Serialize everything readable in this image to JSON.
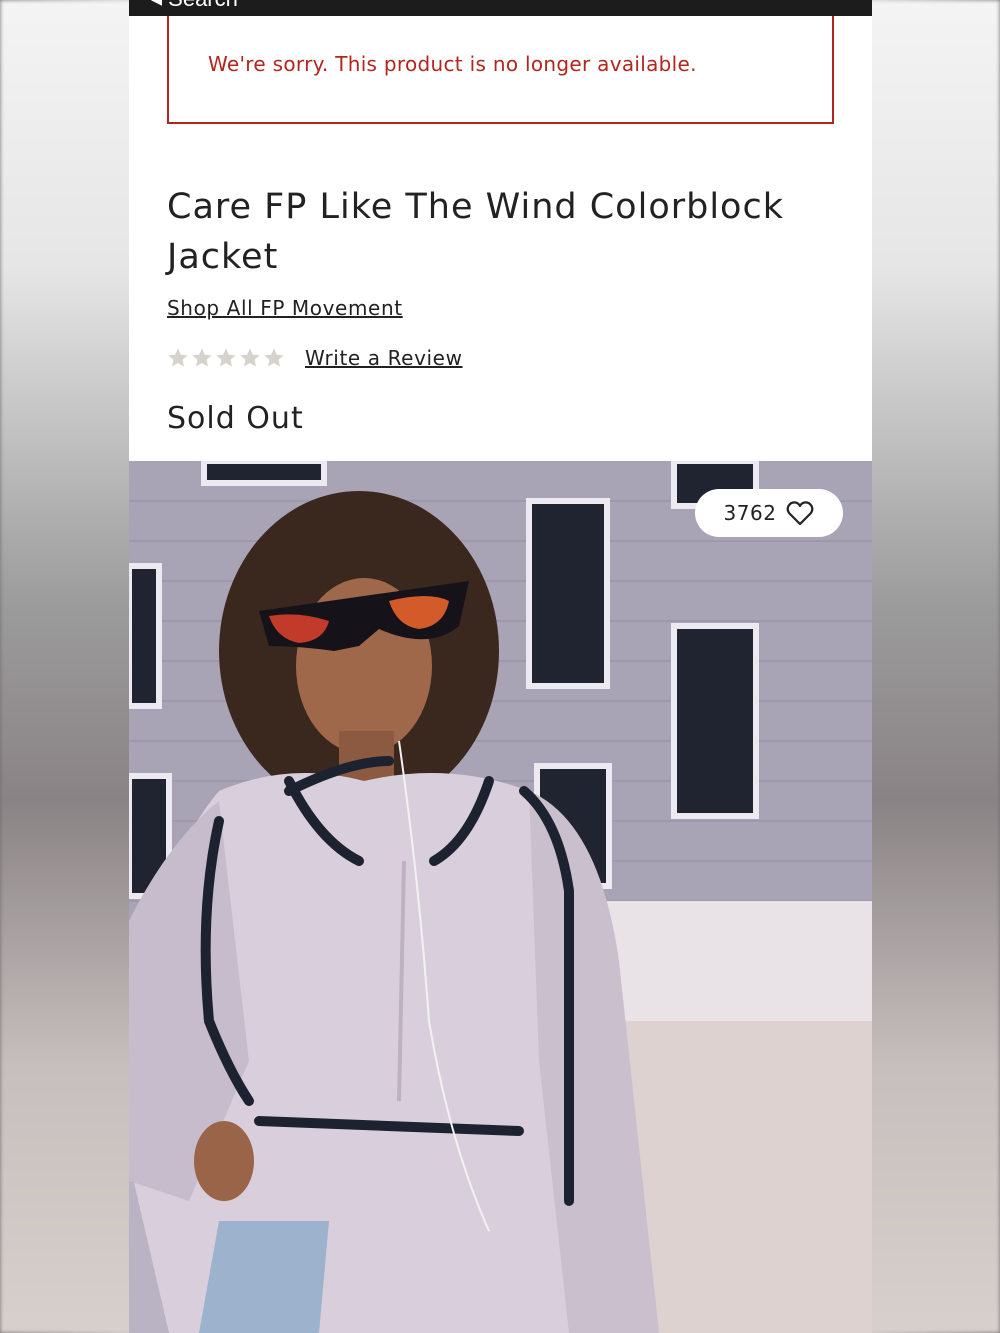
{
  "header": {
    "back_label": "◂ Search"
  },
  "notice": {
    "message": "We're sorry. This product is no longer available."
  },
  "product": {
    "title": "Care FP Like The Wind Colorblock Jacket",
    "shop_all_link": "Shop All FP Movement",
    "rating_stars": 0,
    "write_review_link": "Write a Review",
    "status": "Sold Out",
    "favorites_count": "3762"
  },
  "icons": {
    "star": "star-icon",
    "heart": "heart-icon"
  },
  "colors": {
    "alert": "#b3261e",
    "text": "#222222",
    "star_empty": "#d6d2cc"
  }
}
